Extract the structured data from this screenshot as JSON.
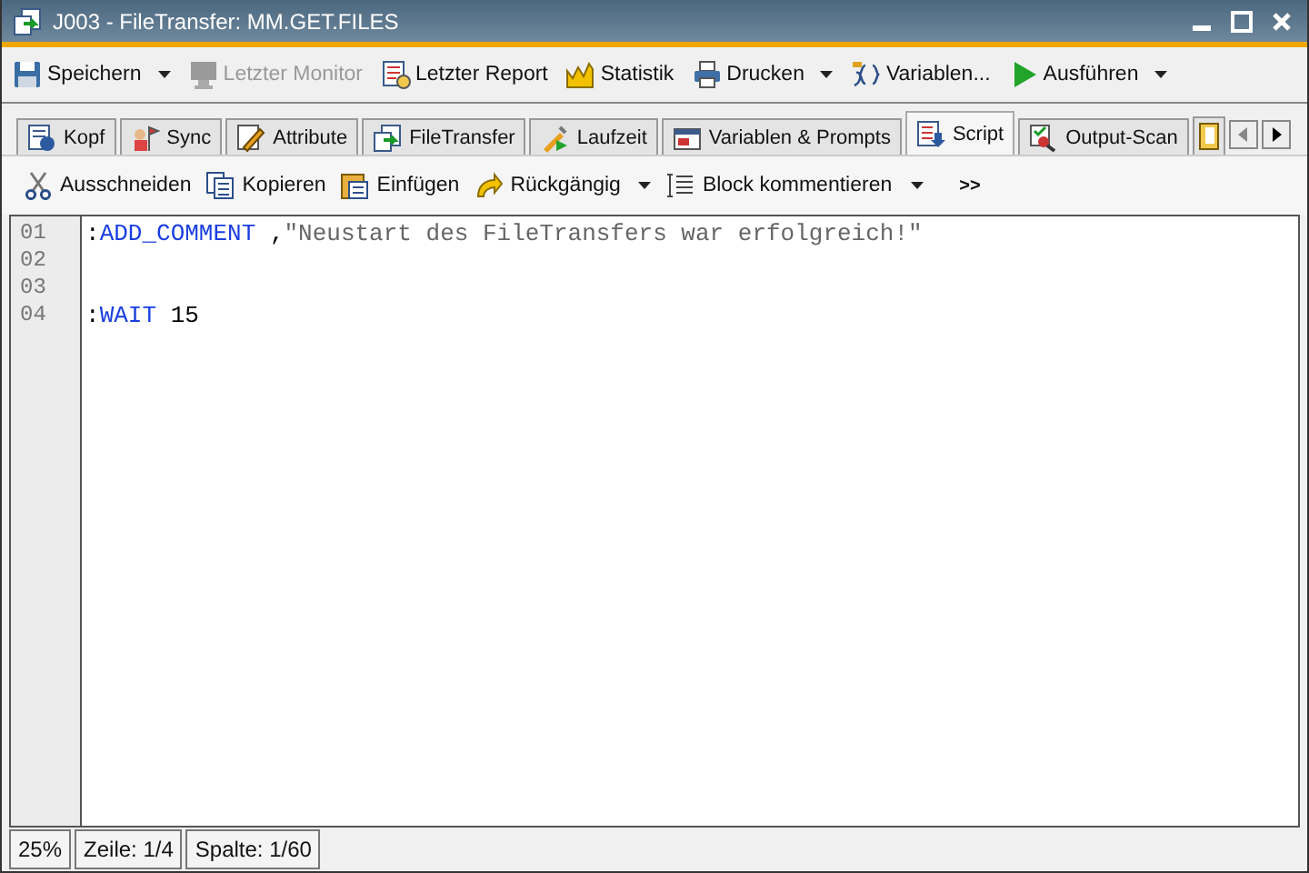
{
  "window": {
    "title": "J003 - FileTransfer: MM.GET.FILES"
  },
  "toolbar": [
    {
      "label": "Speichern",
      "dropdown": true,
      "disabled": false
    },
    {
      "label": "Letzter Monitor",
      "dropdown": false,
      "disabled": true
    },
    {
      "label": "Letzter Report",
      "dropdown": false,
      "disabled": false
    },
    {
      "label": "Statistik",
      "dropdown": false,
      "disabled": false
    },
    {
      "label": "Drucken",
      "dropdown": true,
      "disabled": false
    },
    {
      "label": "Variablen...",
      "dropdown": false,
      "disabled": false
    },
    {
      "label": "Ausführen",
      "dropdown": true,
      "disabled": false
    }
  ],
  "tabs": [
    {
      "label": "Kopf",
      "selected": false
    },
    {
      "label": "Sync",
      "selected": false
    },
    {
      "label": "Attribute",
      "selected": false
    },
    {
      "label": "FileTransfer",
      "selected": false
    },
    {
      "label": "Laufzeit",
      "selected": false
    },
    {
      "label": "Variablen & Prompts",
      "selected": false
    },
    {
      "label": "Script",
      "selected": true
    },
    {
      "label": "Output-Scan",
      "selected": false
    }
  ],
  "edit_toolbar": {
    "items": [
      {
        "label": "Ausschneiden",
        "dropdown": false
      },
      {
        "label": "Kopieren",
        "dropdown": false
      },
      {
        "label": "Einfügen",
        "dropdown": false
      },
      {
        "label": "Rückgängig",
        "dropdown": true
      },
      {
        "label": "Block kommentieren",
        "dropdown": true
      }
    ],
    "overflow": ">>"
  },
  "editor": {
    "lines": [
      {
        "number": "01",
        "tokens": [
          {
            "kind": "punct",
            "text": ":"
          },
          {
            "kind": "keyword",
            "text": "ADD_COMMENT"
          },
          {
            "kind": "punct",
            "text": " ,"
          },
          {
            "kind": "string",
            "text": "\"Neustart des FileTransfers war erfolgreich!\""
          }
        ]
      },
      {
        "number": "02"
      },
      {
        "number": "03"
      },
      {
        "number": "04",
        "tokens": [
          {
            "kind": "punct",
            "text": ":"
          },
          {
            "kind": "keyword",
            "text": "WAIT"
          },
          {
            "kind": "plain",
            "text": " 15"
          }
        ]
      }
    ]
  },
  "status_bar": [
    "25%",
    "Zeile: 1/4",
    "Spalte: 1/60"
  ]
}
